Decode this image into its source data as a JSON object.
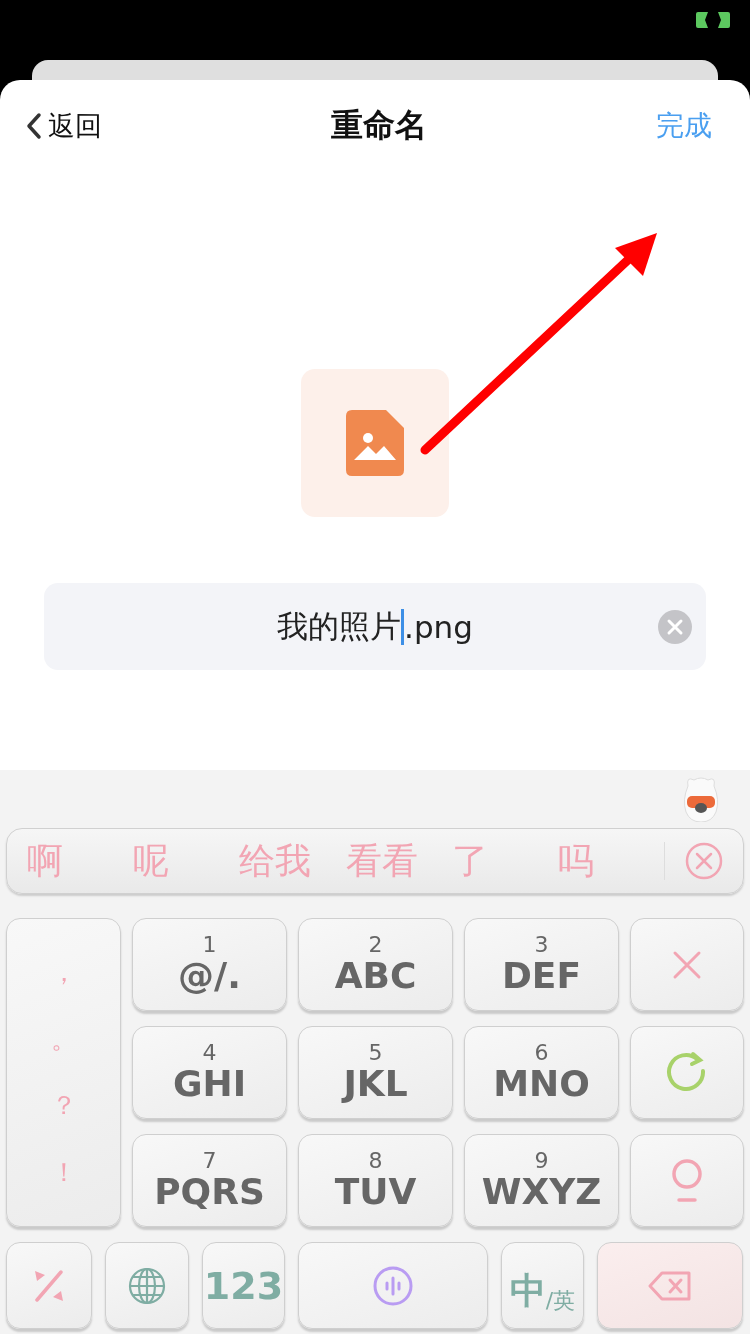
{
  "header": {
    "back": "返回",
    "title": "重命名",
    "done": "完成"
  },
  "name_field": {
    "text_before_cursor": "我的照片",
    "text_after_cursor": ".png"
  },
  "keyboard": {
    "candidates": [
      "啊",
      "呢",
      "给我",
      "看看",
      "了",
      "吗"
    ],
    "punctuation": [
      "，",
      "。",
      "？",
      "！"
    ],
    "keys": [
      {
        "digit": "1",
        "letters": "@/."
      },
      {
        "digit": "2",
        "letters": "ABC"
      },
      {
        "digit": "3",
        "letters": "DEF"
      },
      {
        "digit": "4",
        "letters": "GHI"
      },
      {
        "digit": "5",
        "letters": "JKL"
      },
      {
        "digit": "6",
        "letters": "MNO"
      },
      {
        "digit": "7",
        "letters": "PQRS"
      },
      {
        "digit": "8",
        "letters": "TUV"
      },
      {
        "digit": "9",
        "letters": "WXYZ"
      }
    ],
    "side_keys": [
      {
        "kind": "clear"
      },
      {
        "kind": "reenter"
      },
      {
        "kind": "zero"
      }
    ],
    "bottom_keys": [
      {
        "kind": "symbol"
      },
      {
        "kind": "globe"
      },
      {
        "kind": "text",
        "label": "123"
      },
      {
        "kind": "voice"
      },
      {
        "kind": "lang",
        "main": "中",
        "sub": "/英"
      },
      {
        "kind": "delete"
      }
    ]
  }
}
